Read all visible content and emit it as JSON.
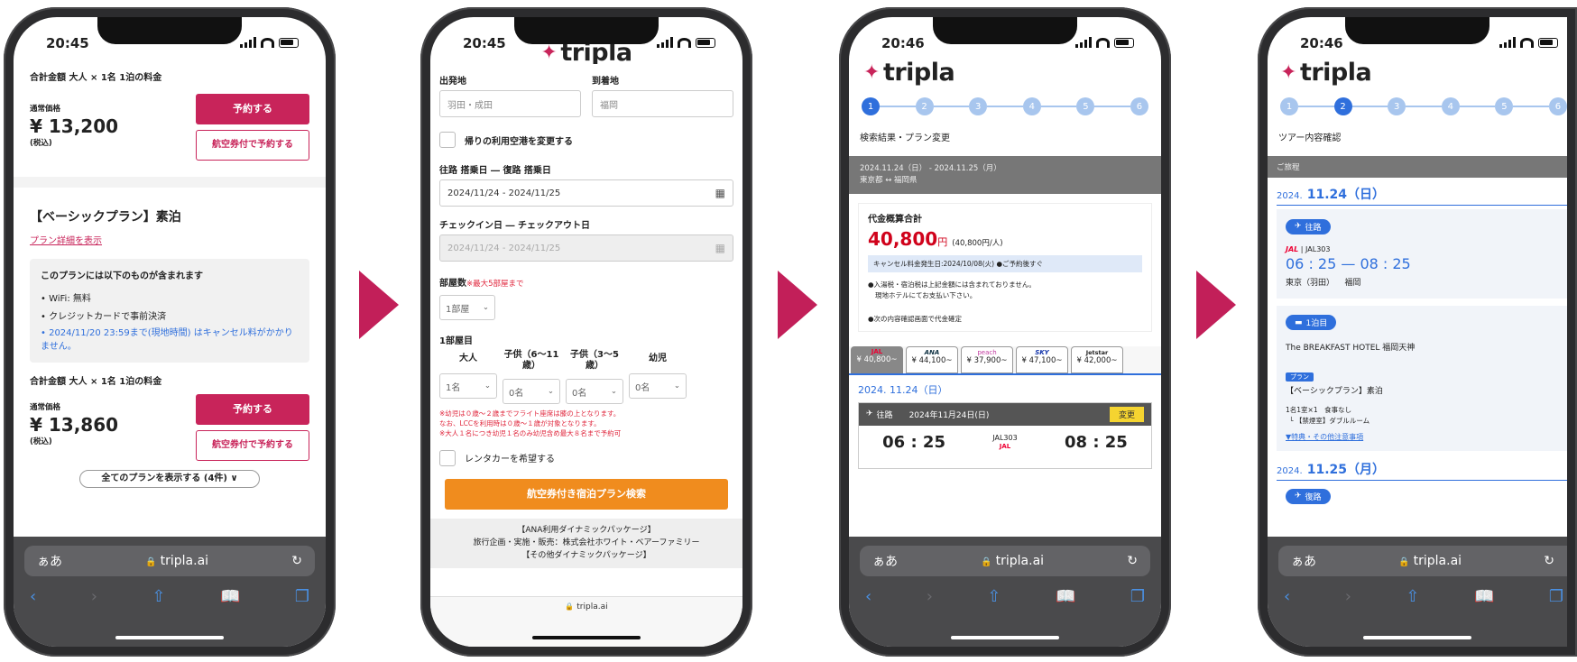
{
  "status_bar": {
    "time_1": "20:45",
    "time_2": "20:45",
    "time_3": "20:46",
    "time_4": "20:46"
  },
  "browser": {
    "font_size_label": "ぁあ",
    "url": "tripla.ai",
    "reload_icon": "reload-icon",
    "back_icon": "chevron-left-icon",
    "forward_icon": "chevron-right-icon",
    "share_icon": "share-icon",
    "bookmarks_icon": "book-icon",
    "tabs_icon": "tabs-icon",
    "screen2_footer_url": "tripla.ai"
  },
  "colors": {
    "accent": "#c8245a",
    "orange": "#f08c1e",
    "blue": "#2f6fdc",
    "price_red": "#d0021b"
  },
  "phone1": {
    "total_label_top": "合計金額 大人 × 1名 1泊の料金",
    "plan1": {
      "regular_price_label": "通常価格",
      "price": "¥ 13,200",
      "tax_label": "(税込)",
      "book_button": "予約する",
      "book_with_flight_button": "航空券付で予約する"
    },
    "plan2": {
      "title": "【ベーシックプラン】素泊",
      "details_link": "プラン詳細を表示",
      "includes_heading": "このプランには以下のものが含まれます",
      "includes": [
        "WiFi: 無料",
        "クレジットカードで事前決済",
        "2024/11/20 23:59まで(現地時間) はキャンセル料がかかりません。"
      ],
      "total_label": "合計金額 大人 × 1名 1泊の料金",
      "regular_price_label": "通常価格",
      "price": "¥ 13,860",
      "tax_label": "(税込)",
      "book_button": "予約する",
      "book_with_flight_button": "航空券付で予約する"
    },
    "show_all_button": "全てのプランを表示する (4件) ∨"
  },
  "phone2": {
    "logo": "tripla",
    "departure_label": "出発地",
    "departure_placeholder": "羽田・成田",
    "arrival_label": "到着地",
    "arrival_placeholder": "福岡",
    "change_return_airport": "帰りの利用空港を変更する",
    "flight_dates_label": "往路 搭乗日 ― 復路 搭乗日",
    "flight_dates_value": "2024/11/24 - 2024/11/25",
    "stay_dates_label": "チェックイン日 ― チェックアウト日",
    "stay_dates_value": "2024/11/24 - 2024/11/25",
    "rooms_label": "部屋数",
    "rooms_note": "※最大5部屋まで",
    "rooms_value": "1部屋",
    "room1_heading": "1部屋目",
    "adults_label": "大人",
    "child_6_11_label": "子供（6〜11歳）",
    "child_3_5_label": "子供（3〜5歳）",
    "infant_label": "幼児",
    "adults_value": "1名",
    "child_6_11_value": "0名",
    "child_3_5_value": "0名",
    "infant_value": "0名",
    "notes": [
      "※幼児は０歳〜２歳までフライト座席は膝の上となります。",
      "なお、LCCを利用時は０歳〜１歳が対象となります。",
      "※大人１名につき幼児１名のみ幼児含め最大８名まで予約可"
    ],
    "rental_car": "レンタカーを希望する",
    "search_button": "航空券付き宿泊プラン検索",
    "footer_lines": [
      "【ANA利用ダイナミックパッケージ】",
      "旅行企画・実施・販売：株式会社ホワイト・ベアーファミリー",
      "【その他ダイナミックパッケージ】"
    ]
  },
  "phone3": {
    "logo": "tripla",
    "steps": [
      "1",
      "2",
      "3",
      "4",
      "5",
      "6"
    ],
    "page_title": "検索結果・プラン変更",
    "trip_dates": "2024.11.24（日） - 2024.11.25（月）",
    "trip_route": "東京都 ↔ 福岡県",
    "total_heading": "代金概算合計",
    "total_price": "40,800",
    "total_yen": "円",
    "per_person": "(40,800円/人)",
    "cancel_notice": "キャンセル料金発生日:2024/10/08(火) ●ご予約後すぐ",
    "tax_note": "●入湯税・宿泊税は上記金額には含まれておりません。",
    "tax_note2": "現地ホテルにてお支払い下さい。",
    "confirm_note": "●次の内容確認画面で代金確定",
    "airlines": [
      {
        "name": "JAL",
        "price": "¥ 40,800~"
      },
      {
        "name": "ANA",
        "price": "¥ 44,100~"
      },
      {
        "name": "peach",
        "price": "¥ 37,900~"
      },
      {
        "name": "SKY",
        "price": "¥ 47,100~"
      },
      {
        "name": "Jetstar",
        "price": "¥ 42,000~"
      }
    ],
    "date_heading": "2024. 11.24（日）",
    "outbound_label": "往路",
    "outbound_date": "2024年11月24日(日)",
    "change_button": "変更",
    "dep_time": "06 : 25",
    "flight_no": "JAL303",
    "airline_logo": "JAL",
    "arr_time": "08 : 25",
    "dep_airport": "東京（羽田）",
    "arr_airport": "福岡"
  },
  "phone4": {
    "logo": "tripla",
    "steps": [
      "1",
      "2",
      "3",
      "4",
      "5",
      "6"
    ],
    "page_title": "ツアー内容確認",
    "itinerary_label": "ご旅程",
    "day1_year": "2024.",
    "day1_date": "11.24（日）",
    "outbound_tag": "往路",
    "airline_logo": "JAL",
    "flight_no": "JAL303",
    "times": "06 : 25 — 08 : 25",
    "dep_airport": "東京（羽田）",
    "arr_airport": "福岡",
    "night_tag": "1泊目",
    "hotel_name": "The BREAKFAST HOTEL 福岡天神",
    "plan_tag": "プラン",
    "plan_name": "【ベーシックプラン】素泊",
    "room_line": "1名1室×1　食事なし",
    "room_type": "└ 【禁煙室】ダブルルーム",
    "benefits_link": "▼特典・その他注意事項",
    "day2_year": "2024.",
    "day2_date": "11.25（月）",
    "return_tag": "復路"
  }
}
